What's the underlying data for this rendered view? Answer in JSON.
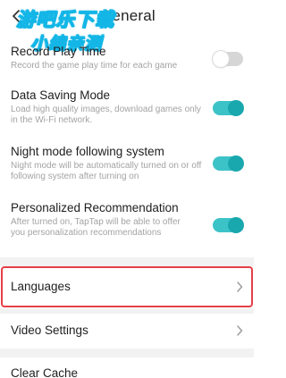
{
  "header": {
    "title": "General",
    "watermark_line1": "游吧乐下载",
    "watermark_line2": "小编亲测"
  },
  "settings": [
    {
      "title": "Record Play Time",
      "description": "Record the game play time for each game",
      "enabled": false
    },
    {
      "title": "Data Saving Mode",
      "description": "Load high quality images, download games only in the Wi-Fi network.",
      "enabled": true
    },
    {
      "title": "Night mode following system",
      "description": "Night mode will be automatically turned on or off following system after turning on",
      "enabled": true
    },
    {
      "title": "Personalized Recommendation",
      "description": "After turned on, TapTap will be able to offer you personalization recommendations",
      "enabled": true
    }
  ],
  "nav": {
    "languages": "Languages",
    "video_settings": "Video Settings",
    "clear_cache": "Clear Cache"
  },
  "colors": {
    "accent": "#19a8ae",
    "highlight": "#e63f47",
    "watermark": "#13b6e6"
  },
  "icons": {
    "back": "arrow-left-icon",
    "chevron": "chevron-right-icon"
  }
}
